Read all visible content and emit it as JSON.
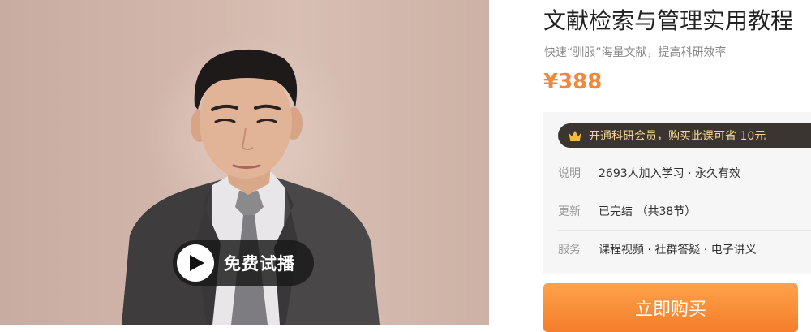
{
  "course": {
    "title": "文献检索与管理实用教程",
    "subtitle": "快速“驯服”海量文献，提高科研效率",
    "price": "¥388"
  },
  "preview": {
    "play_label": "免费试播"
  },
  "vip": {
    "text": "开通科研会员，购买此课可省 10元",
    "icon": "crown-icon"
  },
  "info": [
    {
      "key": "说明",
      "value": "2693人加入学习 · 永久有效"
    },
    {
      "key": "更新",
      "value": "已完结 （共38节）"
    },
    {
      "key": "服务",
      "value": "课程视频 · 社群答疑 · 电子讲义"
    }
  ],
  "buy": {
    "label": "立即购买"
  },
  "colors": {
    "price": "#f08a3a",
    "buy_button": "#f47d2b",
    "vip_bar": "#3a3530",
    "vip_text": "#f6d598"
  }
}
